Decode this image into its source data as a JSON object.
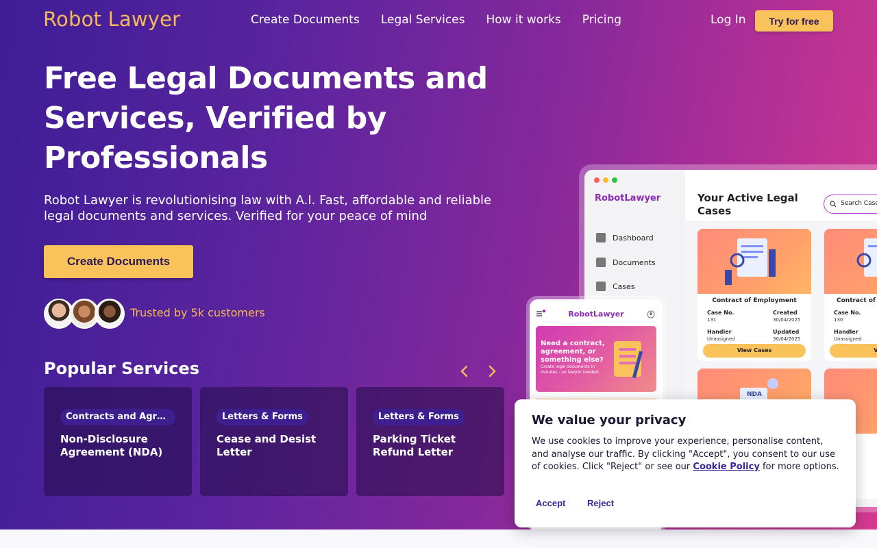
{
  "brand": {
    "logo": "Robot Lawyer",
    "accent": "#f9c25b",
    "primary": "#3d1d96"
  },
  "nav": {
    "links": [
      "Create Documents",
      "Legal Services",
      "How it works",
      "Pricing"
    ],
    "login": "Log In",
    "try_free": "Try for free"
  },
  "hero": {
    "headline": "Free Legal Documents and Services, Verified by Professionals",
    "subtext": "Robot Lawyer is revolutionising law with A.I. Fast, affordable and reliable legal documents and services. Verified for your peace of mind",
    "cta": "Create Documents",
    "trusted": "Trusted by 5k customers"
  },
  "popular": {
    "title": "Popular Services",
    "prev_icon": "chevron-left-icon",
    "next_icon": "chevron-right-icon",
    "cards": [
      {
        "tag": "Contracts and Agreements",
        "title": "Non-Disclosure Agreement (NDA)"
      },
      {
        "tag": "Letters & Forms",
        "title": "Cease and Desist Letter"
      },
      {
        "tag": "Letters & Forms",
        "title": "Parking Ticket Refund Letter"
      }
    ]
  },
  "mockup": {
    "logo": "RobotLawyer",
    "sidebar": [
      "Dashboard",
      "Documents",
      "Cases"
    ],
    "heading": "Your Active Legal Cases",
    "search": "Search Case",
    "cases": [
      {
        "title": "Contract of Employment",
        "case_no_label": "Case No.",
        "case_no": "131",
        "created_label": "Created",
        "created": "30/04/2025",
        "handler_label": "Handler",
        "handler": "Unassigned",
        "updated_label": "Updated",
        "updated": "30/04/2025",
        "button": "View Cases"
      },
      {
        "title": "Contract of",
        "case_no_label": "Case No.",
        "case_no": "130",
        "handler_label": "Handler",
        "handler": "Unassigned",
        "button": "View"
      }
    ],
    "second_row_tag": "NDA",
    "phone_logo": "RobotLawyer",
    "phone_banner_title": "Need a contract, agreement, or something else?",
    "phone_banner_sub": "Create legal documents in minutes - no lawyer needed."
  },
  "cookie": {
    "title": "We value your privacy",
    "text_before": "We use cookies to improve your experience, personalise content, and analyse our traffic. By clicking \"Accept\", you consent to our use of cookies. Click \"Reject\" or see our ",
    "link": "Cookie Policy",
    "text_after": " for more options.",
    "accept": "Accept",
    "reject": "Reject"
  }
}
